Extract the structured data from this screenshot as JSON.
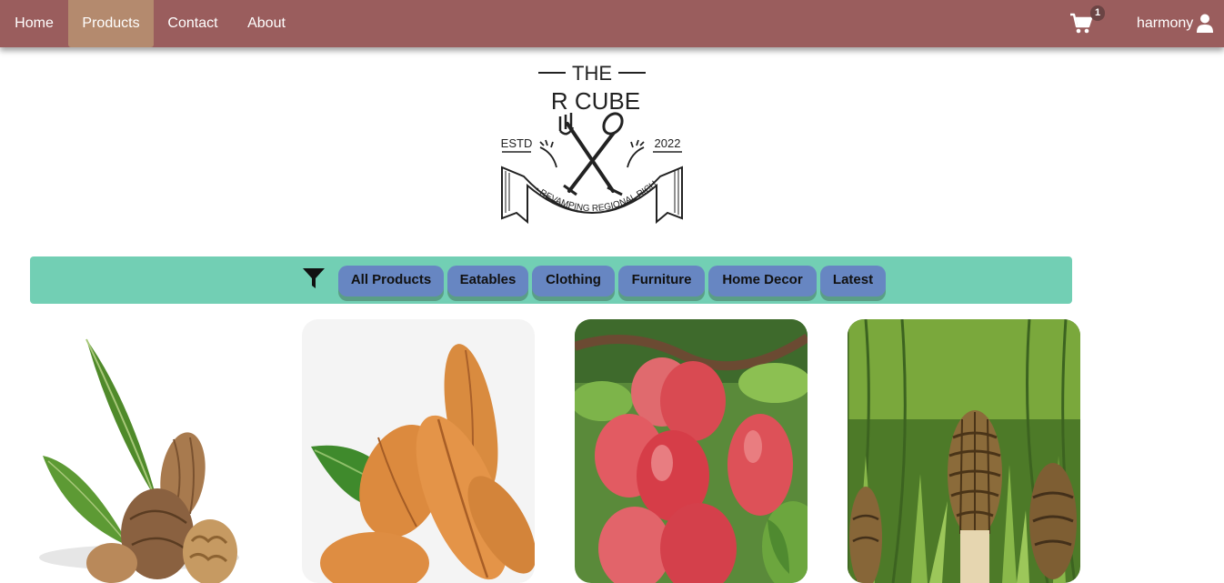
{
  "nav": {
    "items": [
      {
        "label": "Home"
      },
      {
        "label": "Products"
      },
      {
        "label": "Contact"
      },
      {
        "label": "About"
      }
    ],
    "cart_count": "1",
    "username": "harmony",
    "colors": {
      "bar": "#9a5d5d",
      "active": "#b48a6e"
    }
  },
  "logo": {
    "line1": "THE",
    "line2": "R CUBE",
    "left_text": "ESTD",
    "right_text": "2022",
    "ribbon": "• REVAMPING REGIONAL RICHNESS •"
  },
  "filters": {
    "icon": "filter-icon",
    "items": [
      {
        "label": "All Products"
      },
      {
        "label": "Eatables"
      },
      {
        "label": "Clothing"
      },
      {
        "label": "Furniture"
      },
      {
        "label": "Home Decor"
      },
      {
        "label": "Latest"
      }
    ],
    "colors": {
      "bar": "#72cfb4",
      "chip": "#6786c2"
    }
  },
  "products": [
    {
      "image": "walnuts"
    },
    {
      "image": "almonds"
    },
    {
      "image": "apples"
    },
    {
      "image": "morel mushrooms"
    }
  ]
}
